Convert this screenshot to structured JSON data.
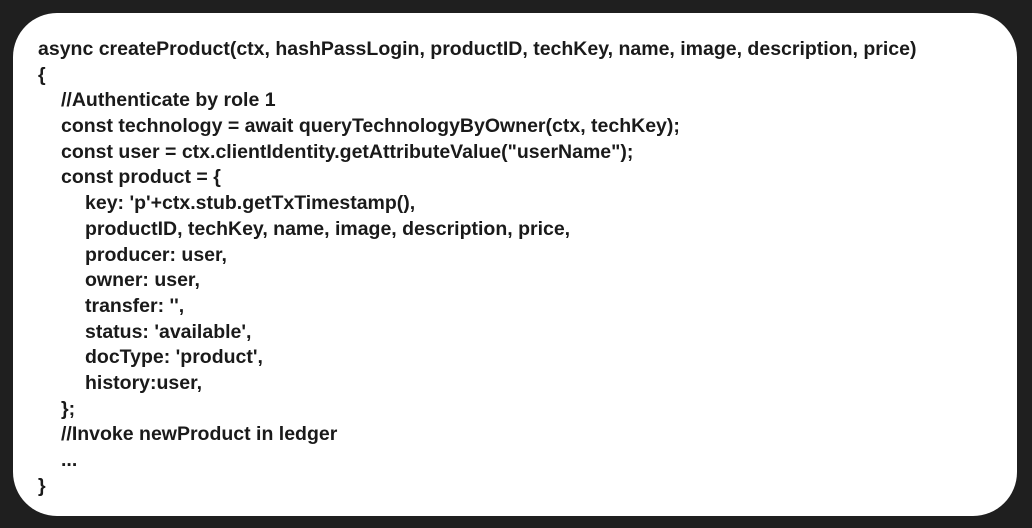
{
  "code": {
    "lines": [
      "async createProduct(ctx, hashPassLogin, productID, techKey, name, image, description, price)",
      "{",
      "//Authenticate by role 1",
      "const technology = await queryTechnologyByOwner(ctx, techKey);",
      "const user = ctx.clientIdentity.getAttributeValue(\"userName\");",
      "const product = {",
      "key: 'p'+ctx.stub.getTxTimestamp(),",
      "productID, techKey, name, image, description, price,",
      "producer: user,",
      "owner: user,",
      "transfer: '',",
      "status: 'available',",
      "docType: 'product',",
      "history:user,",
      "};",
      "//Invoke newProduct in ledger",
      "...",
      "}"
    ]
  }
}
